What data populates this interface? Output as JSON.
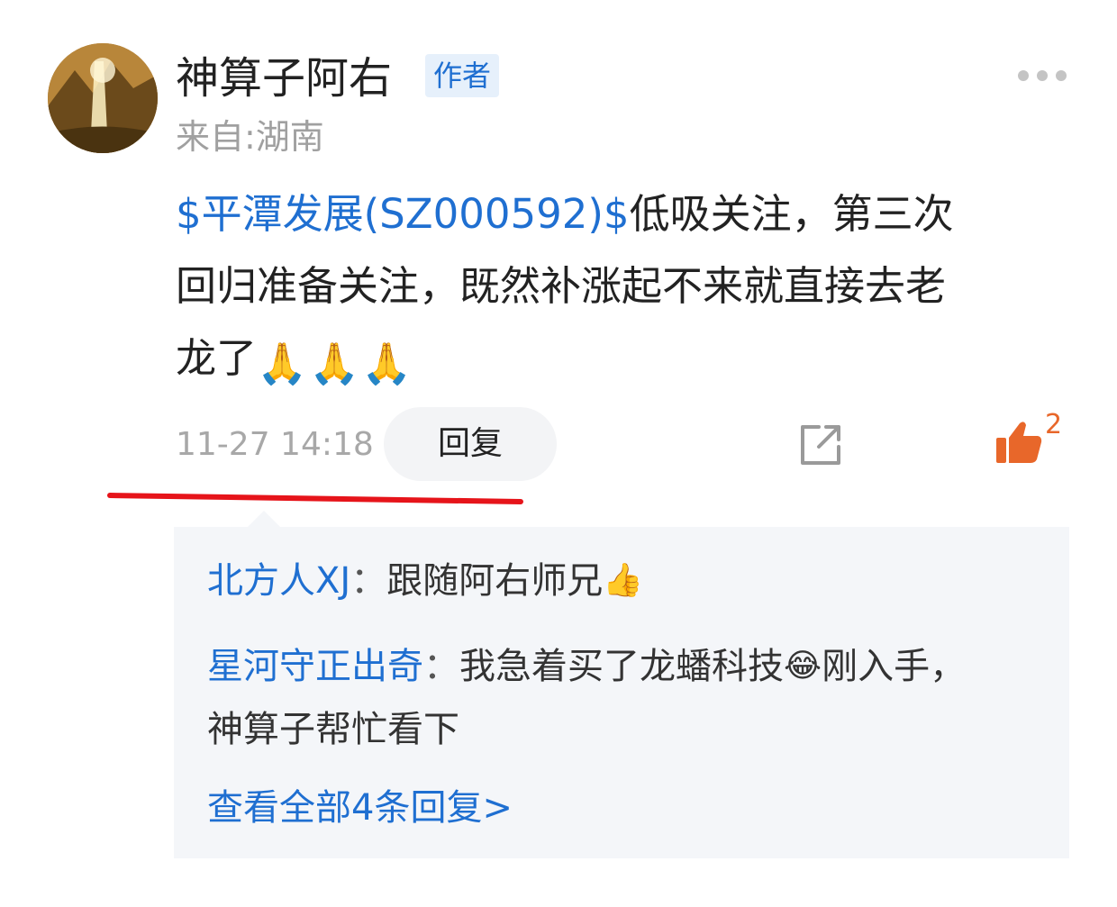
{
  "post": {
    "author": "神算子阿右",
    "badge": "作者",
    "location": "来自:湖南",
    "stock_link": "$平潭发展(SZ000592)$",
    "text_line1": "低吸关注，第三次",
    "text_line2": "回归准备关注，既然补涨起不来就直接去老",
    "text_line3": "龙了",
    "emoji_hands": "🙏🙏🙏",
    "time": "11-27 14:18",
    "reply_label": "回复",
    "like_count": "2"
  },
  "icons": {
    "more": "more-dots-icon",
    "share": "share-icon",
    "like": "thumbs-up-icon"
  },
  "colors": {
    "link_blue": "#1f6fd1",
    "like_orange": "#e8672a",
    "underline_red": "#e6141a",
    "reply_box_bg": "#f4f6f9"
  },
  "replies": [
    {
      "user": "北方人XJ",
      "sep": "：",
      "text": "跟随阿右师兄",
      "emoji": "👍"
    },
    {
      "user": "星河守正出奇",
      "sep": "：",
      "text_before": "我急着买了龙蟠科技",
      "emoji": "😂",
      "text_after": "刚入手，神算子帮忙看下"
    }
  ],
  "view_all": "查看全部4条回复>"
}
